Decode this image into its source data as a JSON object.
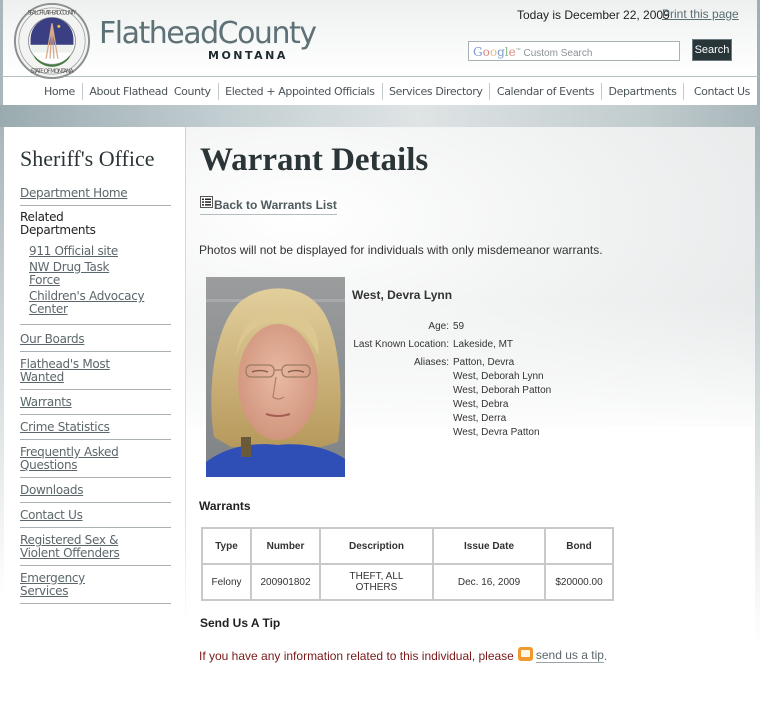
{
  "header": {
    "brand_main": "FlatheadCounty",
    "brand_sub": "MONTANA",
    "seal_top_text": "SEAL OF FLATHEAD COUNTY",
    "seal_bottom_text": "STATE OF MONTANA",
    "today": "Today is December 22, 2009",
    "print_label": "Print this page",
    "search": {
      "placeholder_brand": "Google",
      "placeholder_text": "Custom Search",
      "button_label": "Search"
    }
  },
  "nav": {
    "items": [
      "Home",
      "About Flathead  County",
      "Elected + Appointed Officials",
      "Services Directory",
      "Calendar of Events",
      "Departments",
      "Contact Us"
    ]
  },
  "sidebar": {
    "title": "Sheriff's Office",
    "department_home": "Department Home",
    "related_label": "Related Departments",
    "related": [
      "911 Official site",
      "NW Drug Task Force",
      "Children's Advocacy Center"
    ],
    "links": [
      "Our Boards",
      "Flathead's Most Wanted",
      "Warrants",
      "Crime Statistics",
      "Frequently Asked Questions",
      "Downloads",
      "Contact Us",
      "Registered Sex & Violent Offenders",
      "Emergency Services"
    ]
  },
  "main": {
    "title": "Warrant Details",
    "back_label": "Back to Warrants List",
    "notice": "Photos will not be displayed for individuals with only misdemeanor warrants.",
    "person": {
      "name": "West, Devra Lynn",
      "age_label": "Age:",
      "age": "59",
      "location_label": "Last Known Location:",
      "location": "Lakeside, MT",
      "aliases_label": "Aliases:",
      "aliases": [
        "Patton, Devra",
        "West, Deborah Lynn",
        "West, Deborah Patton",
        "West, Debra",
        "West, Derra",
        "West, Devra Patton"
      ]
    },
    "warrants_heading": "Warrants",
    "warrants_table": {
      "headers": [
        "Type",
        "Number",
        "Description",
        "Issue Date",
        "Bond"
      ],
      "rows": [
        [
          "Felony",
          "200901802",
          "THEFT, ALL OTHERS",
          "Dec. 16, 2009",
          "$20000.00"
        ]
      ]
    },
    "tip_heading": "Send Us A Tip",
    "tip_text": "If you have any information related to this individual, please",
    "tip_link": "send us a tip",
    "tip_end": "."
  },
  "colors": {
    "brand": "#5e7176",
    "nav_band": "#a9b6ba",
    "search_button": "#28363a",
    "tip_text": "#7a1a1a",
    "mail_icon": "#f09a2e"
  }
}
